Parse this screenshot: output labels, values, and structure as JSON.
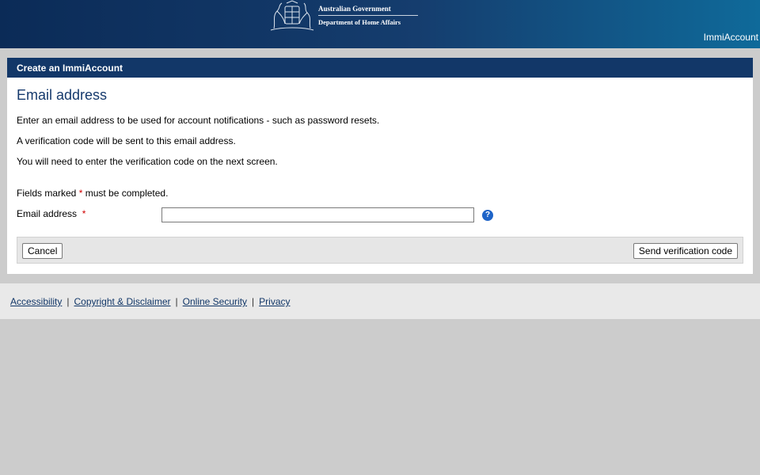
{
  "header": {
    "gov_line1": "Australian Government",
    "gov_line2": "Department of Home Affairs",
    "brand": "ImmiAccount",
    "crest_icon": "coat-of-arms-icon"
  },
  "panel": {
    "title": "Create an ImmiAccount",
    "heading": "Email address",
    "paragraphs": [
      "Enter an email address to be used for account notifications - such as password resets.",
      "A verification code will be sent to this email address.",
      "You will need to enter the verification code on the next screen."
    ],
    "fields_note_prefix": "Fields marked ",
    "required_marker": "*",
    "fields_note_suffix": " must be completed.",
    "email_label": "Email address",
    "email_value": "",
    "help_icon": "help-question-icon",
    "help_glyph": "?",
    "cancel_label": "Cancel",
    "send_label": "Send verification code"
  },
  "footer": {
    "links": [
      "Accessibility",
      "Copyright & Disclaimer",
      "Online Security",
      "Privacy"
    ],
    "separator": "|"
  },
  "colors": {
    "header_dark": "#0b2b57",
    "header_light": "#0f6a9a",
    "title_bar": "#123768",
    "required": "#d00000",
    "help": "#1e64c8"
  }
}
